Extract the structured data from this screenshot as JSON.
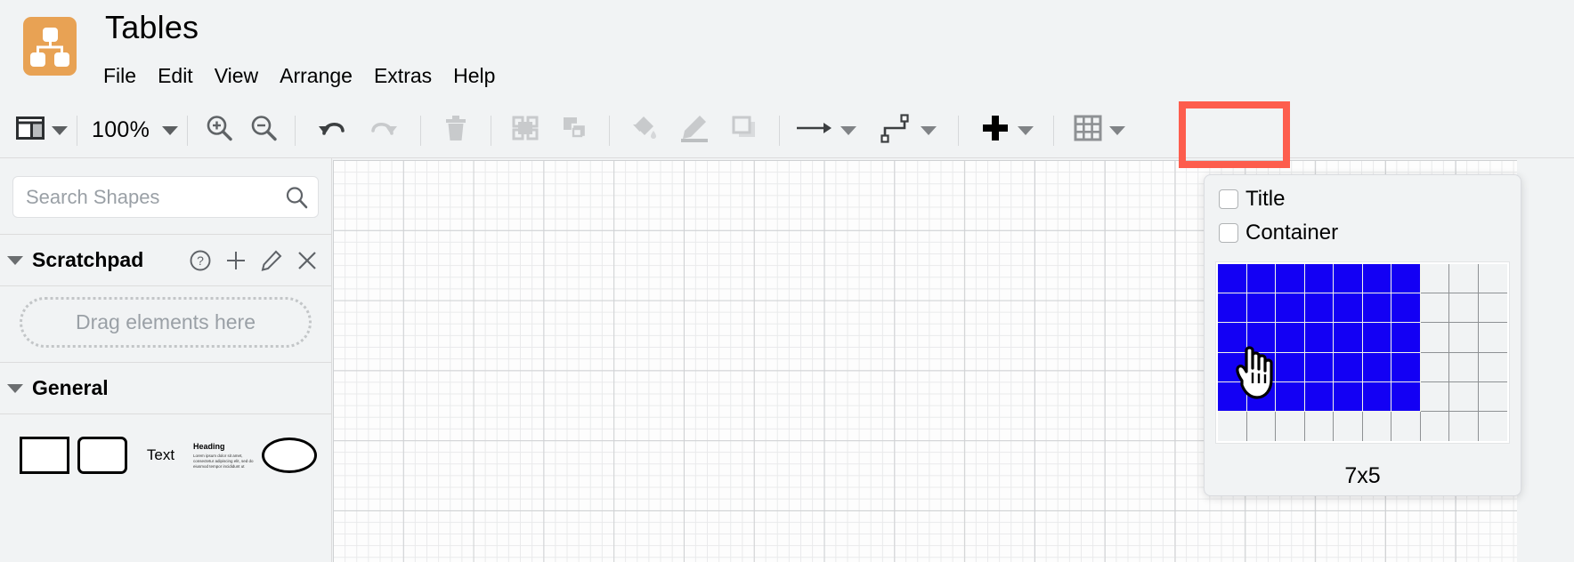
{
  "app": {
    "title": "Tables",
    "logo_icon": "drawio-logo-icon"
  },
  "menubar": {
    "items": [
      {
        "label": "File"
      },
      {
        "label": "Edit"
      },
      {
        "label": "View"
      },
      {
        "label": "Arrange"
      },
      {
        "label": "Extras"
      },
      {
        "label": "Help"
      }
    ]
  },
  "toolbar": {
    "view_layout_icon": "panel-layout-icon",
    "zoom_value": "100%",
    "zoom_in_icon": "zoom-in-icon",
    "zoom_out_icon": "zoom-out-icon",
    "undo_icon": "undo-icon",
    "redo_icon": "redo-icon",
    "delete_icon": "trash-icon",
    "to_front_icon": "bring-to-front-icon",
    "to_back_icon": "send-to-back-icon",
    "fill_color_icon": "fill-bucket-icon",
    "line_color_icon": "pencil-line-icon",
    "shadow_icon": "shadow-square-icon",
    "waypoints_icon": "straight-arrow-icon",
    "connection_icon": "orthogonal-connector-icon",
    "insert_icon": "plus-icon",
    "table_icon": "table-grid-icon",
    "highlight_color": "#fd5d4d"
  },
  "sidebar": {
    "search": {
      "placeholder": "Search Shapes",
      "value": "",
      "icon": "search-icon"
    },
    "scratchpad": {
      "title": "Scratchpad",
      "collapse_icon": "caret-down-icon",
      "actions": [
        {
          "icon": "help-circle-icon"
        },
        {
          "icon": "plus-icon"
        },
        {
          "icon": "edit-pencil-icon"
        },
        {
          "icon": "close-x-icon"
        }
      ],
      "dropzone_text": "Drag elements here"
    },
    "general": {
      "title": "General",
      "collapse_icon": "caret-down-icon",
      "shapes": [
        {
          "name": "rectangle",
          "label": ""
        },
        {
          "name": "rounded-rectangle",
          "label": ""
        },
        {
          "name": "text",
          "label": "Text"
        },
        {
          "name": "textbox",
          "heading": "Heading",
          "body": "Lorem ipsum dolor sit amet, consectetur adipiscing elit, sed do eiusmod tempor incididunt ut"
        },
        {
          "name": "ellipse",
          "label": ""
        }
      ]
    }
  },
  "table_dropdown": {
    "options": [
      {
        "label": "Title",
        "checked": false
      },
      {
        "label": "Container",
        "checked": false
      }
    ],
    "grid": {
      "columns": 10,
      "rows": 6,
      "selected_columns": 7,
      "selected_rows": 5,
      "selected_color": "#1300f4",
      "empty_color": "#f1f3f4"
    },
    "size_label": "7x5",
    "cursor_icon": "pointing-hand-cursor-icon"
  },
  "canvas": {
    "grid_visible": true,
    "zoom": "100%"
  }
}
